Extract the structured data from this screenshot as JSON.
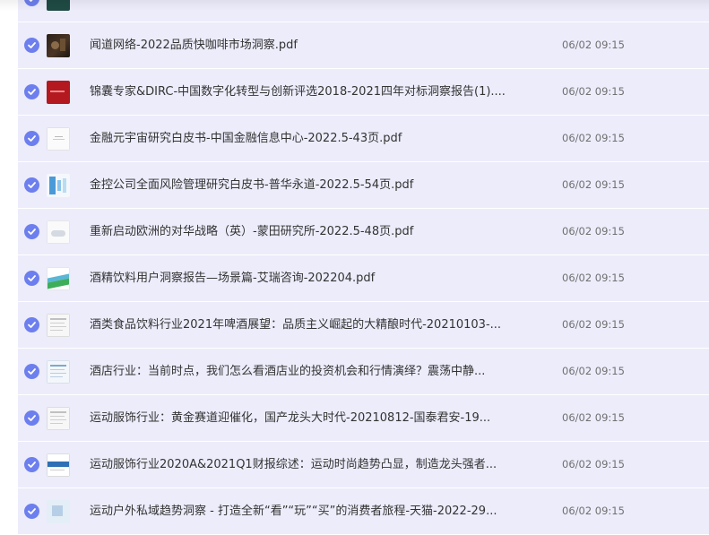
{
  "files": [
    {
      "name": "",
      "time": "",
      "thumb": "dark-teal"
    },
    {
      "name": "闻道网络-2022品质快咖啡市场洞察.pdf",
      "time": "06/02 09:15",
      "thumb": "coffee"
    },
    {
      "name": "锦囊专家&DIRC-中国数字化转型与创新评选2018-2021四年对标洞察报告(1)....",
      "time": "06/02 09:15",
      "thumb": "red"
    },
    {
      "name": "金融元宇宙研究白皮书-中国金融信息中心-2022.5-43页.pdf",
      "time": "06/02 09:15",
      "thumb": "white-doc"
    },
    {
      "name": "金控公司全面风险管理研究白皮书-普华永道-2022.5-54页.pdf",
      "time": "06/02 09:15",
      "thumb": "blue-bars"
    },
    {
      "name": "重新启动欧洲的对华战略（英）-蒙田研究所-2022.5-48页.pdf",
      "time": "06/02 09:15",
      "thumb": "cloud"
    },
    {
      "name": "酒精饮料用户洞察报告—场景篇-艾瑞咨询-202204.pdf",
      "time": "06/02 09:15",
      "thumb": "green-wave"
    },
    {
      "name": "酒类食品饮料行业2021年啤酒展望：品质主义崛起的大精酿时代-20210103-...",
      "time": "06/02 09:15",
      "thumb": "text-doc"
    },
    {
      "name": "酒店行业：当前时点，我们怎么看酒店业的投资机会和行情演绎？震荡中静...",
      "time": "06/02 09:15",
      "thumb": "text-doc-blue"
    },
    {
      "name": "运动服饰行业：黄金赛道迎催化，国产龙头大时代-20210812-国泰君安-19...",
      "time": "06/02 09:15",
      "thumb": "text-doc"
    },
    {
      "name": "运动服饰行业2020A&2021Q1财报综述：运动时尚趋势凸显，制造龙头强者...",
      "time": "06/02 09:15",
      "thumb": "blue-header"
    },
    {
      "name": "运动户外私域趋势洞察 - 打造全新“看”“玩”“买”的消费者旅程-天猫-2022-29...",
      "time": "06/02 09:15",
      "thumb": "light-blue"
    }
  ],
  "icons": {
    "check": "check-circle-icon"
  },
  "colors": {
    "row_bg": "#ececfb",
    "check": "#6d7fee",
    "filename": "#333333",
    "time": "#707070"
  }
}
